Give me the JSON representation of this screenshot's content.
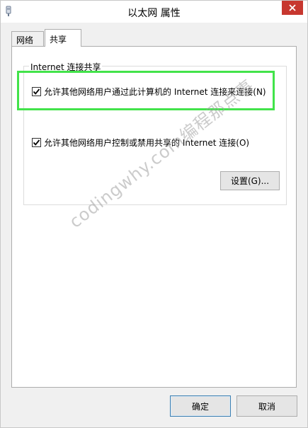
{
  "window": {
    "title": "以太网 属性"
  },
  "tabs": [
    {
      "label": "网络",
      "selected": false
    },
    {
      "label": "共享",
      "selected": true
    }
  ],
  "sharing": {
    "group_label": "Internet 连接共享",
    "allow_connection": {
      "label": "允许其他网络用户通过此计算机的 Internet 连接来连接(N)",
      "checked": true
    },
    "allow_control": {
      "label": "允许其他网络用户控制或禁用共享的 Internet 连接(O)",
      "checked": true
    },
    "settings_button": "设置(G)..."
  },
  "watermark": "codingwhy.com编程那点事",
  "footer": {
    "ok_label": "确定",
    "cancel_label": "取消"
  },
  "colors": {
    "highlight": "#42e34a",
    "close": "#c7372f"
  }
}
